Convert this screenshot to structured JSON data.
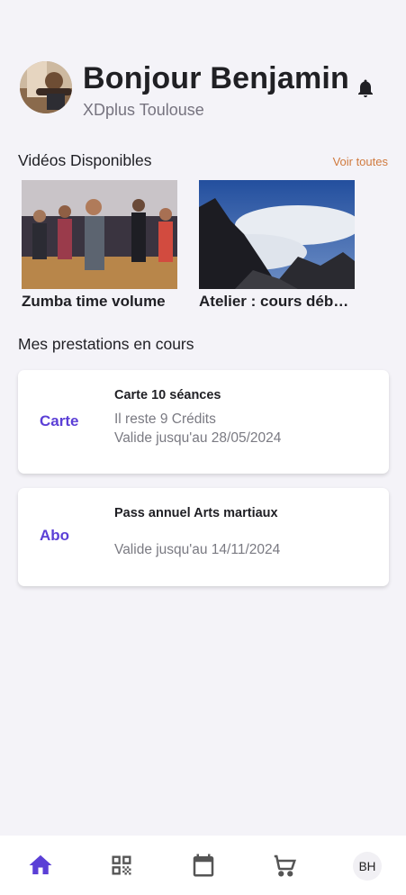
{
  "header": {
    "greeting": "Bonjour Benjamin",
    "club": "XDplus Toulouse"
  },
  "videos": {
    "section_title": "Vidéos Disponibles",
    "see_all": "Voir toutes",
    "items": [
      {
        "title": "Zumba time volume"
      },
      {
        "title": "Atelier : cours débutants"
      }
    ]
  },
  "services": {
    "section_title": "Mes prestations en cours",
    "items": [
      {
        "kind": "Carte",
        "title": "Carte 10 séances",
        "credits": "Il reste 9 Crédits",
        "validity": "Valide jusqu'au 28/05/2024"
      },
      {
        "kind": "Abo",
        "title": "Pass annuel Arts martiaux",
        "validity": "Valide jusqu'au 14/11/2024"
      }
    ]
  },
  "nav": {
    "items": [
      "home-icon",
      "qr-code-icon",
      "calendar-icon",
      "cart-icon"
    ],
    "initials": "BH",
    "active_color": "#5b3fd6",
    "inactive_color": "#555555"
  }
}
